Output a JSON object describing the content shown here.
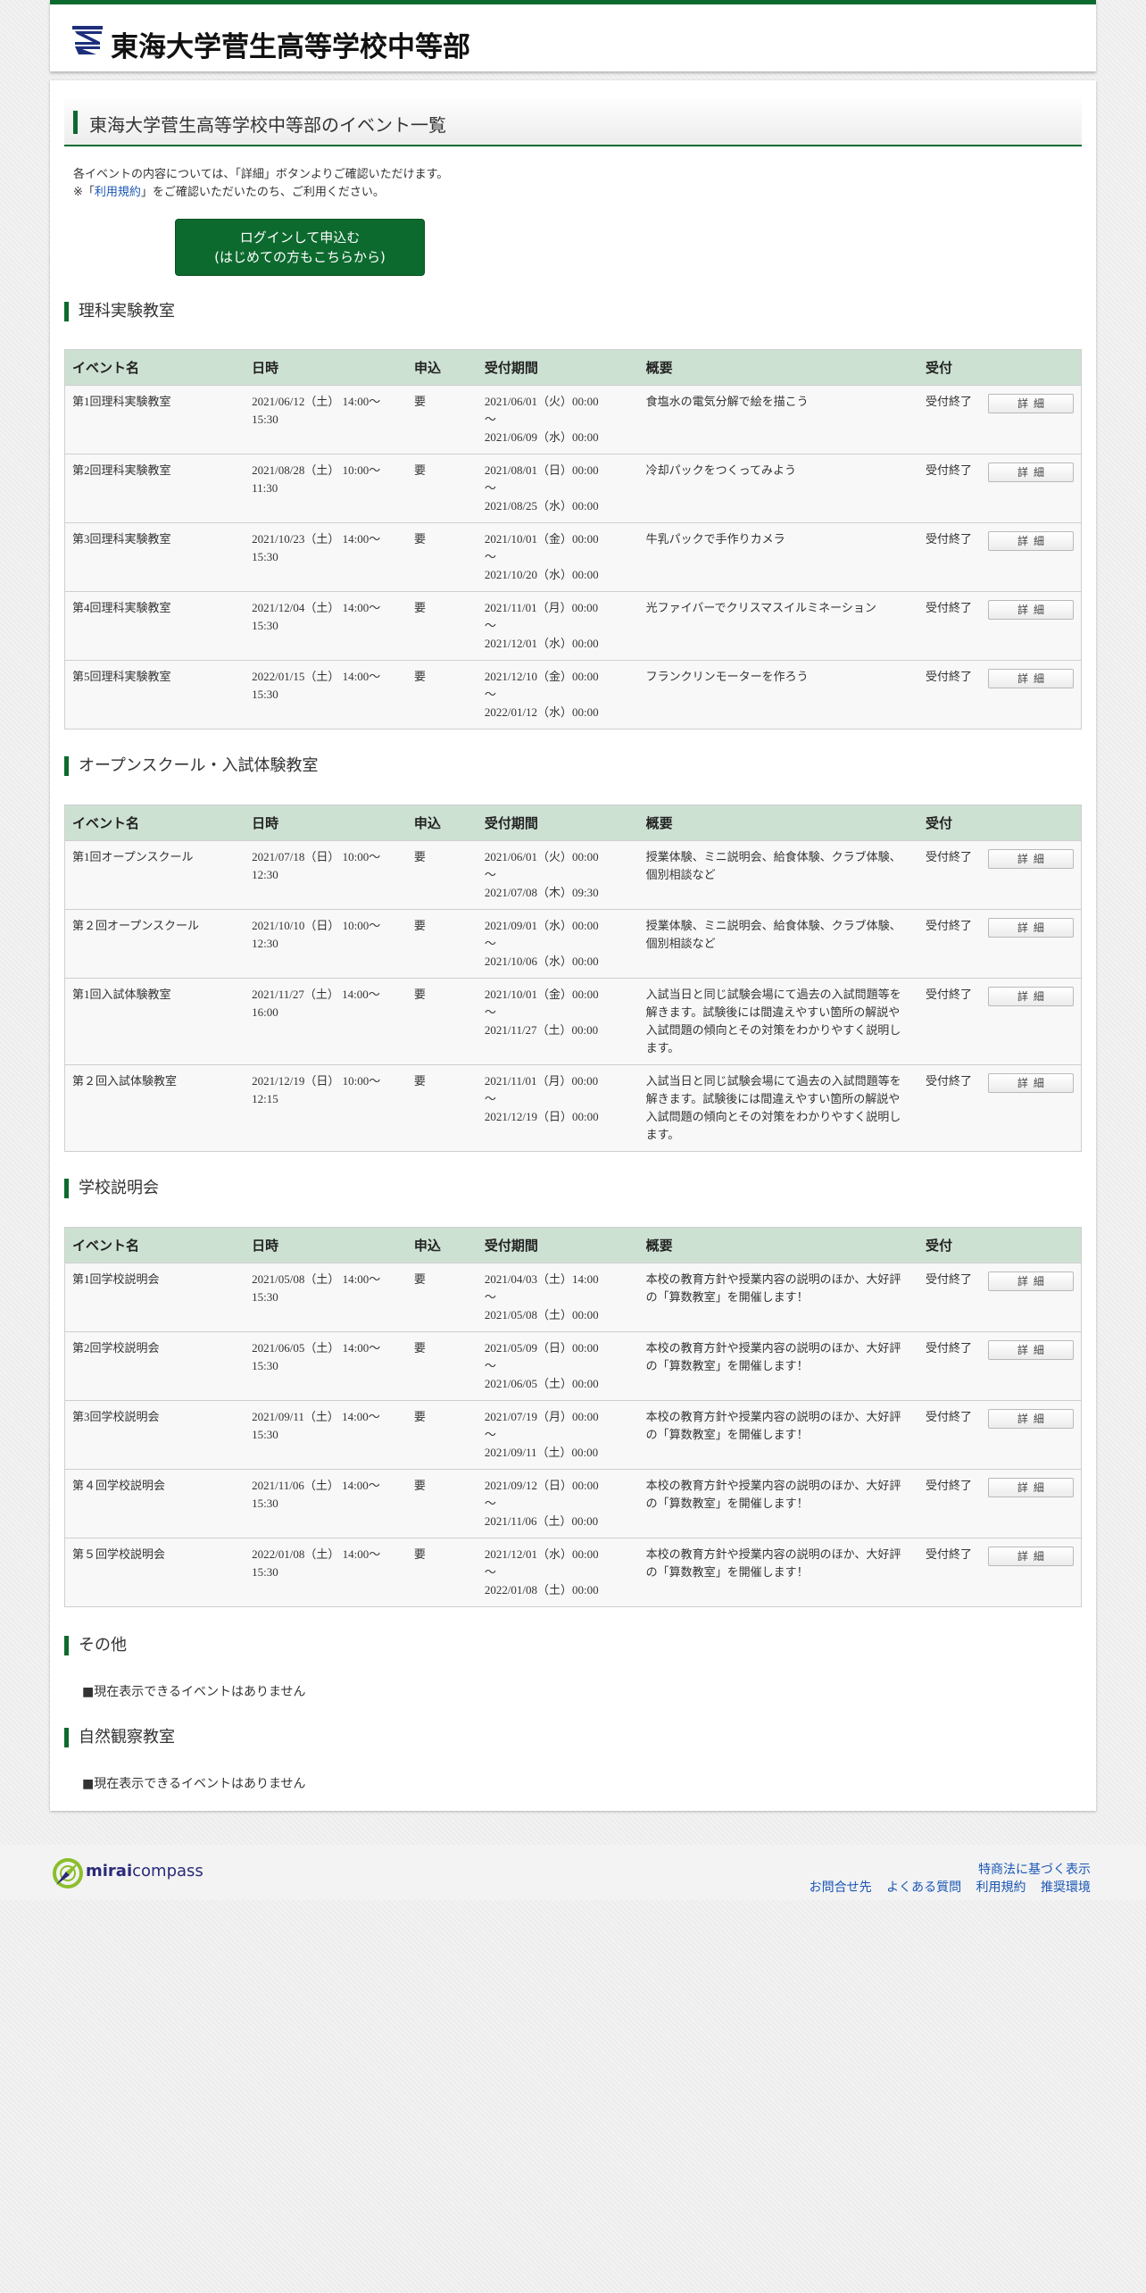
{
  "header": {
    "school_name": "東海大学菅生高等学校中等部"
  },
  "page": {
    "title": "東海大学菅生高等学校中等部のイベント一覧",
    "intro_line1": "各イベントの内容については、「詳細」ボタンよりご確認いただけます。",
    "intro_prefix": "※「",
    "terms_link": "利用規約",
    "intro_suffix": "」をご確認いただいたのち、ご利用ください。",
    "login_line1": "ログインして申込む",
    "login_line2": "(はじめての方もこちらから)"
  },
  "columns": [
    "イベント名",
    "日時",
    "申込",
    "受付期間",
    "概要",
    "受付"
  ],
  "detail_label": "詳細",
  "sections": [
    {
      "title": "理科実験教室",
      "events": [
        {
          "name": "第1回理科実験教室",
          "date1": "2021/06/12（土） 14:00～",
          "date2": "15:30",
          "req": "要",
          "p1": "2021/06/01（火）00:00",
          "p2": "～",
          "p3": "2021/06/09（水）00:00",
          "summary": "食塩水の電気分解で絵を描こう",
          "status": "受付終了"
        },
        {
          "name": "第2回理科実験教室",
          "date1": "2021/08/28（土） 10:00～",
          "date2": "11:30",
          "req": "要",
          "p1": "2021/08/01（日）00:00",
          "p2": "～",
          "p3": "2021/08/25（水）00:00",
          "summary": "冷却パックをつくってみよう",
          "status": "受付終了"
        },
        {
          "name": "第3回理科実験教室",
          "date1": "2021/10/23（土） 14:00～",
          "date2": "15:30",
          "req": "要",
          "p1": "2021/10/01（金）00:00",
          "p2": "～",
          "p3": "2021/10/20（水）00:00",
          "summary": "牛乳パックで手作りカメラ",
          "status": "受付終了"
        },
        {
          "name": "第4回理科実験教室",
          "date1": "2021/12/04（土） 14:00～",
          "date2": "15:30",
          "req": "要",
          "p1": "2021/11/01（月）00:00",
          "p2": "～",
          "p3": "2021/12/01（水）00:00",
          "summary": "光ファイバーでクリスマスイルミネーション",
          "status": "受付終了"
        },
        {
          "name": "第5回理科実験教室",
          "date1": "2022/01/15（土） 14:00～",
          "date2": "15:30",
          "req": "要",
          "p1": "2021/12/10（金）00:00",
          "p2": "～",
          "p3": "2022/01/12（水）00:00",
          "summary": "フランクリンモーターを作ろう",
          "status": "受付終了"
        }
      ]
    },
    {
      "title": "オープンスクール・入試体験教室",
      "events": [
        {
          "name": "第1回オープンスクール",
          "date1": "2021/07/18（日） 10:00～",
          "date2": "12:30",
          "req": "要",
          "p1": "2021/06/01（火）00:00",
          "p2": "～",
          "p3": "2021/07/08（木）09:30",
          "summary": "授業体験、ミニ説明会、給食体験、クラブ体験、個別相談など",
          "status": "受付終了"
        },
        {
          "name": "第２回オープンスクール",
          "date1": "2021/10/10（日） 10:00～",
          "date2": "12:30",
          "req": "要",
          "p1": "2021/09/01（水）00:00",
          "p2": "～",
          "p3": "2021/10/06（水）00:00",
          "summary": "授業体験、ミニ説明会、給食体験、クラブ体験、個別相談など",
          "status": "受付終了"
        },
        {
          "name": "第1回入試体験教室",
          "date1": "2021/11/27（土） 14:00～",
          "date2": "16:00",
          "req": "要",
          "p1": "2021/10/01（金）00:00",
          "p2": "～",
          "p3": "2021/11/27（土）00:00",
          "summary": "入試当日と同じ試験会場にて過去の入試問題等を解きます。試験後には間違えやすい箇所の解説や入試問題の傾向とその対策をわかりやすく説明します。",
          "status": "受付終了"
        },
        {
          "name": "第２回入試体験教室",
          "date1": "2021/12/19（日） 10:00～",
          "date2": "12:15",
          "req": "要",
          "p1": "2021/11/01（月）00:00",
          "p2": "～",
          "p3": "2021/12/19（日）00:00",
          "summary": "入試当日と同じ試験会場にて過去の入試問題等を解きます。試験後には間違えやすい箇所の解説や入試問題の傾向とその対策をわかりやすく説明します。",
          "status": "受付終了"
        }
      ]
    },
    {
      "title": "学校説明会",
      "events": [
        {
          "name": "第1回学校説明会",
          "date1": "2021/05/08（土） 14:00～",
          "date2": "15:30",
          "req": "要",
          "p1": "2021/04/03（土）14:00",
          "p2": "～",
          "p3": "2021/05/08（土）00:00",
          "summary": "本校の教育方針や授業内容の説明のほか、大好評の「算数教室」を開催します！",
          "status": "受付終了"
        },
        {
          "name": "第2回学校説明会",
          "date1": "2021/06/05（土） 14:00～",
          "date2": "15:30",
          "req": "要",
          "p1": "2021/05/09（日）00:00",
          "p2": "～",
          "p3": "2021/06/05（土）00:00",
          "summary": "本校の教育方針や授業内容の説明のほか、大好評の「算数教室」を開催します！",
          "status": "受付終了"
        },
        {
          "name": "第3回学校説明会",
          "date1": "2021/09/11（土） 14:00～",
          "date2": "15:30",
          "req": "要",
          "p1": "2021/07/19（月）00:00",
          "p2": "～",
          "p3": "2021/09/11（土）00:00",
          "summary": "本校の教育方針や授業内容の説明のほか、大好評の「算数教室」を開催します！",
          "status": "受付終了"
        },
        {
          "name": "第４回学校説明会",
          "date1": "2021/11/06（土） 14:00～",
          "date2": "15:30",
          "req": "要",
          "p1": "2021/09/12（日）00:00",
          "p2": "～",
          "p3": "2021/11/06（土）00:00",
          "summary": "本校の教育方針や授業内容の説明のほか、大好評の「算数教室」を開催します！",
          "status": "受付終了"
        },
        {
          "name": "第５回学校説明会",
          "date1": "2022/01/08（土） 14:00～",
          "date2": "15:30",
          "req": "要",
          "p1": "2021/12/01（水）00:00",
          "p2": "～",
          "p3": "2022/01/08（土）00:00",
          "summary": "本校の教育方針や授業内容の説明のほか、大好評の「算数教室」を開催します！",
          "status": "受付終了"
        }
      ]
    }
  ],
  "empty_sections": [
    {
      "title": "その他",
      "message": "■現在表示できるイベントはありません"
    },
    {
      "title": "自然観察教室",
      "message": "■現在表示できるイベントはありません"
    }
  ],
  "footer": {
    "brand_bold": "mirai",
    "brand_rest": "compass",
    "link_tokusho": "特商法に基づく表示",
    "link_contact": "お問合せ先",
    "link_faq": "よくある質問",
    "link_terms": "利用規約",
    "link_env": "推奨環境"
  },
  "colors": {
    "brand_green": "#0d6a2f",
    "table_header": "#cde1d3",
    "link_blue": "#1a56b5"
  },
  "icons": [
    "school-logo-icon",
    "miraicompass-logo-icon"
  ]
}
